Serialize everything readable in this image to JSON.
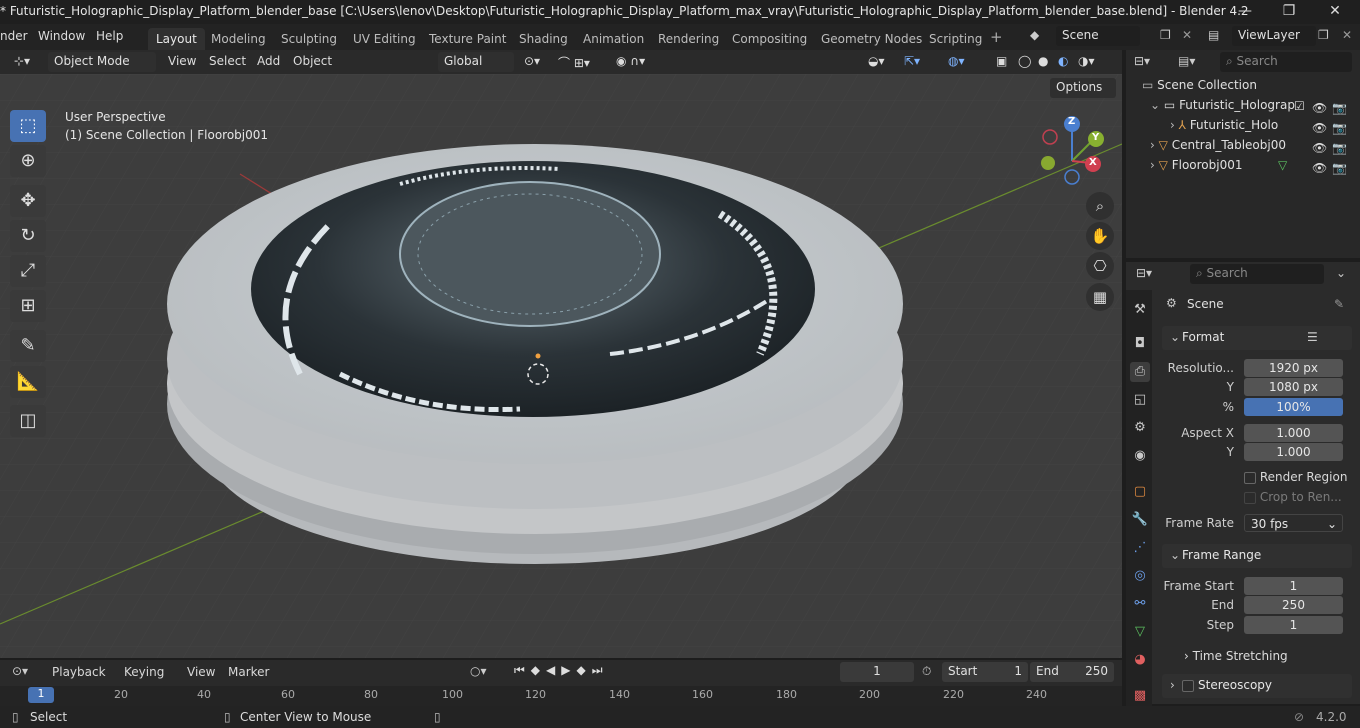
{
  "window": {
    "title": "* Futuristic_Holographic_Display_Platform_blender_base [C:\\Users\\lenov\\Desktop\\Futuristic_Holographic_Display_Platform_max_vray\\Futuristic_Holographic_Display_Platform_blender_base.blend] - Blender 4.2",
    "minimize": "—",
    "maximize": "❐",
    "close": "✕"
  },
  "menus": [
    "nder",
    "Window",
    "Help"
  ],
  "workspaces": [
    "Layout",
    "Modeling",
    "Sculpting",
    "UV Editing",
    "Texture Paint",
    "Shading",
    "Animation",
    "Rendering",
    "Compositing",
    "Geometry Nodes",
    "Scripting"
  ],
  "scene_name": "Scene",
  "view_layer": "ViewLayer",
  "viewport_header": {
    "mode": "Object Mode",
    "menus": [
      "View",
      "Select",
      "Add",
      "Object"
    ],
    "orientation": "Global",
    "options": "Options"
  },
  "viewport": {
    "perspective": "User Perspective",
    "collection": "(1) Scene Collection | Floorobj001",
    "gizmo": {
      "z": "Z",
      "y": "Y",
      "x": "X"
    }
  },
  "outliner": {
    "search_placeholder": "Search",
    "root": "Scene Collection",
    "items": [
      "Futuristic_Holograp",
      "Futuristic_Holo",
      "Central_Tableobj00",
      "Floorobj001"
    ]
  },
  "properties": {
    "search_placeholder": "Search",
    "context": "Scene",
    "format": {
      "header": "Format",
      "resolution_label": "Resolutio...",
      "res_x": "1920 px",
      "y_label": "Y",
      "res_y": "1080 px",
      "pct_label": "%",
      "pct": "100%",
      "aspect_label": "Aspect X",
      "aspect_x": "1.000",
      "aspect_y_label": "Y",
      "aspect_y": "1.000",
      "render_region": "Render Region",
      "crop": "Crop to Ren...",
      "frame_rate_label": "Frame Rate",
      "frame_rate": "30 fps"
    },
    "frame_range": {
      "header": "Frame Range",
      "start_label": "Frame Start",
      "start": "1",
      "end_label": "End",
      "end": "250",
      "step_label": "Step",
      "step": "1"
    },
    "time_stretching": "Time Stretching",
    "stereoscopy": "Stereoscopy"
  },
  "timeline": {
    "menus": [
      "Playback",
      "Keying",
      "View",
      "Marker"
    ],
    "current_frame": "1",
    "start_label": "Start",
    "start": "1",
    "end_label": "End",
    "end": "250",
    "ticks": [
      "1",
      "20",
      "40",
      "60",
      "80",
      "100",
      "120",
      "140",
      "160",
      "180",
      "200",
      "220",
      "240"
    ]
  },
  "statusbar": {
    "select": "Select",
    "center": "Center View to Mouse",
    "version": "4.2.0"
  }
}
